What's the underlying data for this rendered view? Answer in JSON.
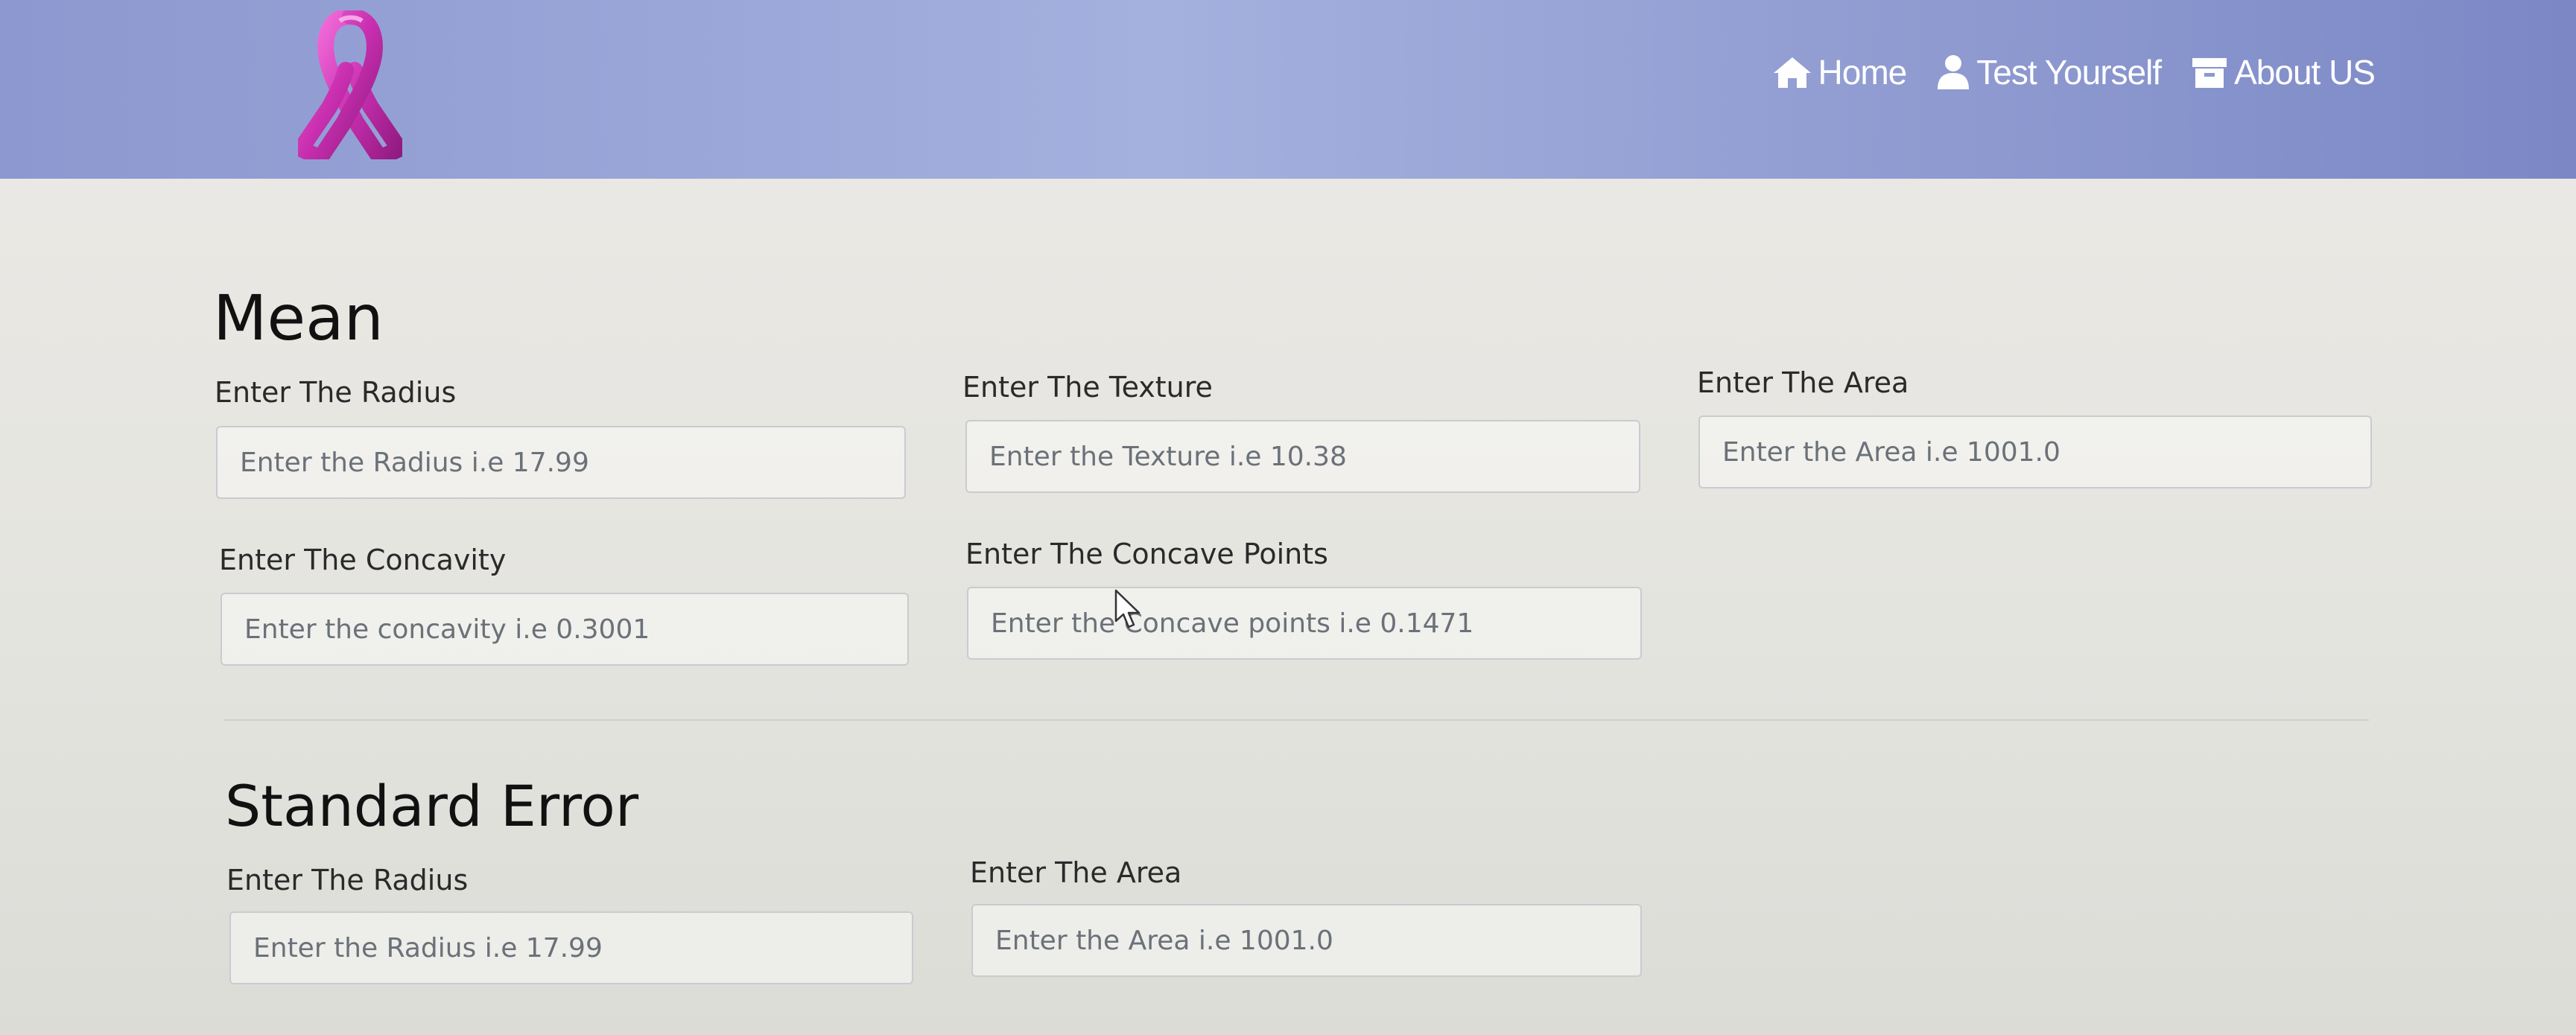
{
  "nav": {
    "home": "Home",
    "test": "Test Yourself",
    "about": "About US"
  },
  "colors": {
    "navbar": "#909cd2",
    "ribbon": "#d13fb8"
  },
  "icons": {
    "brand": "pink-ribbon-icon",
    "home": "home-icon",
    "test": "user-icon",
    "about": "archive-box-icon"
  },
  "mean": {
    "title": "Mean",
    "radius": {
      "label": "Enter The Radius",
      "placeholder": "Enter the Radius i.e 17.99"
    },
    "texture": {
      "label": "Enter The Texture",
      "placeholder": "Enter the Texture i.e 10.38"
    },
    "area": {
      "label": "Enter The Area",
      "placeholder": "Enter the Area i.e 1001.0"
    },
    "concavity": {
      "label": "Enter The Concavity",
      "placeholder": "Enter the concavity i.e 0.3001"
    },
    "concave_points": {
      "label": "Enter The Concave Points",
      "placeholder": "Enter the Concave points i.e 0.1471"
    }
  },
  "standard_error": {
    "title": "Standard Error",
    "radius": {
      "label": "Enter The Radius",
      "placeholder": "Enter the Radius i.e 17.99"
    },
    "area": {
      "label": "Enter The Area",
      "placeholder": "Enter the Area i.e 1001.0"
    }
  }
}
